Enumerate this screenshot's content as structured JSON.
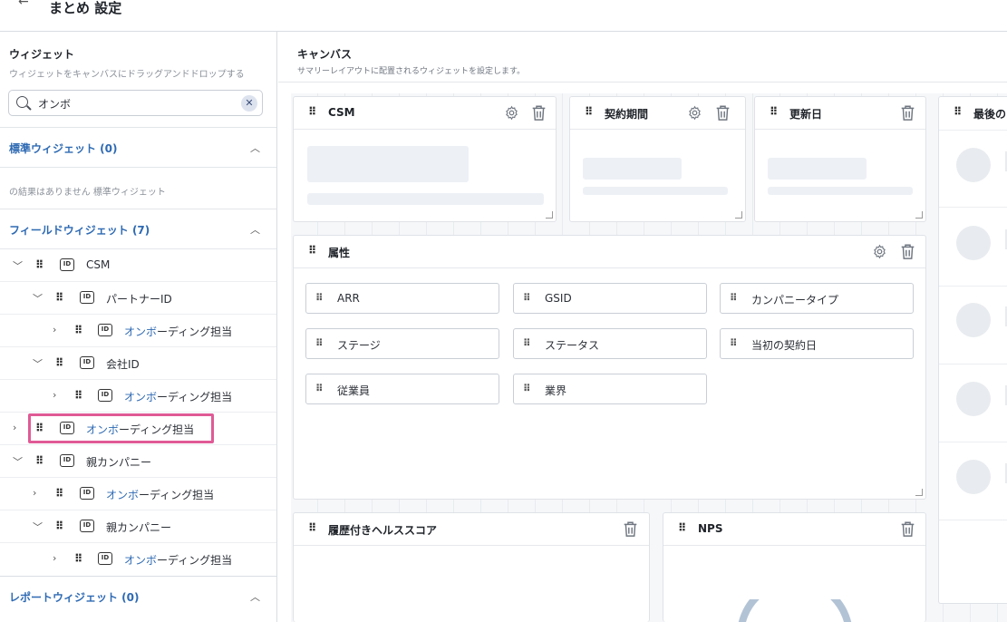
{
  "header": {
    "title": "まとめ 設定"
  },
  "widgets": {
    "title": "ウィジェット",
    "subtitle": "ウィジェットをキャンバスにドラッグアンドドロップする",
    "search_value": "オンボ",
    "standard": {
      "label": "標準ウィジェット (0)",
      "empty": "の結果はありません 標準ウィジェット"
    },
    "field": {
      "label": "フィールドウィジェット (7)"
    },
    "report": {
      "label": "レポートウィジェット (0)"
    },
    "tree": [
      {
        "text": "CSM",
        "match": "",
        "rest": ""
      },
      {
        "text": "パートナーID",
        "match": "",
        "rest": ""
      },
      {
        "text": "",
        "match": "オンボ",
        "rest": "ーディング担当"
      },
      {
        "text": "会社ID",
        "match": "",
        "rest": ""
      },
      {
        "text": "",
        "match": "オンボ",
        "rest": "ーディング担当"
      },
      {
        "text": "",
        "match": "オンボ",
        "rest": "ーディング担当"
      },
      {
        "text": "親カンパニー",
        "match": "",
        "rest": ""
      },
      {
        "text": "",
        "match": "オンボ",
        "rest": "ーディング担当"
      },
      {
        "text": "親カンパニー",
        "match": "",
        "rest": ""
      },
      {
        "text": "",
        "match": "オンボ",
        "rest": "ーディング担当"
      }
    ]
  },
  "canvas": {
    "title": "キャンバス",
    "subtitle": "サマリーレイアウトに配置されるウィジェットを設定します。",
    "cards": {
      "csm": "CSM",
      "contract": "契約期間",
      "renewal": "更新日",
      "last": "最後の",
      "attributes": "属性",
      "health": "履歴付きヘルススコア",
      "nps": "NPS"
    },
    "attributes": [
      "ARR",
      "GSID",
      "カンパニータイプ",
      "ステージ",
      "ステータス",
      "当初の契約日",
      "従業員",
      "業界"
    ]
  }
}
